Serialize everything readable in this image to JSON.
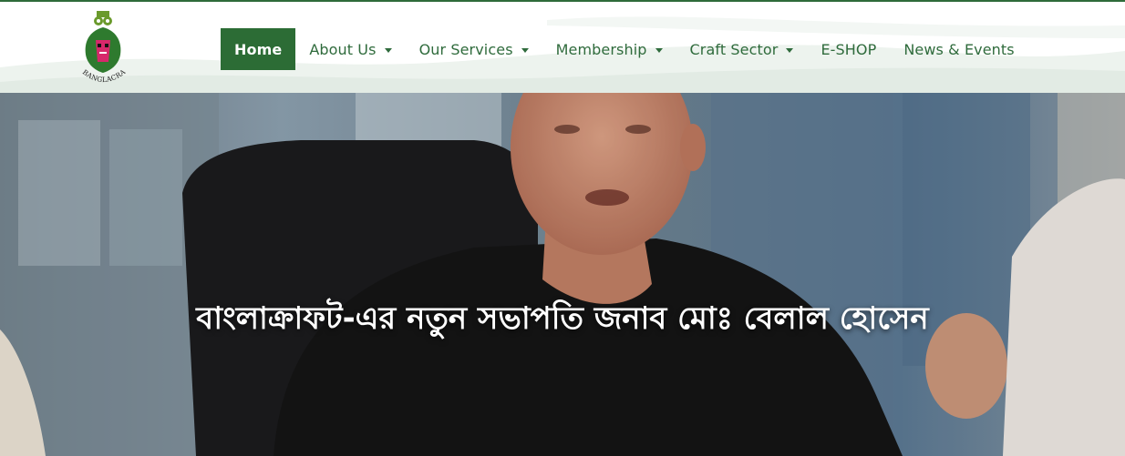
{
  "header": {
    "logo_text": "BANGLACRAFT",
    "nav": [
      {
        "label": "Home",
        "active": true,
        "dropdown": false
      },
      {
        "label": "About Us",
        "active": false,
        "dropdown": true
      },
      {
        "label": "Our Services",
        "active": false,
        "dropdown": true
      },
      {
        "label": "Membership",
        "active": false,
        "dropdown": true
      },
      {
        "label": "Craft Sector",
        "active": false,
        "dropdown": true
      },
      {
        "label": "E-SHOP",
        "active": false,
        "dropdown": false
      },
      {
        "label": "News & Events",
        "active": false,
        "dropdown": false
      }
    ]
  },
  "hero": {
    "title": "বাংলাক্রাফট-এর নতুন সভাপতি জনাব মোঃ বেলাল হোসেন"
  },
  "colors": {
    "brand_green": "#2c6c35",
    "nav_text": "#2f6b3c",
    "header_wave": "#e8efe9"
  }
}
